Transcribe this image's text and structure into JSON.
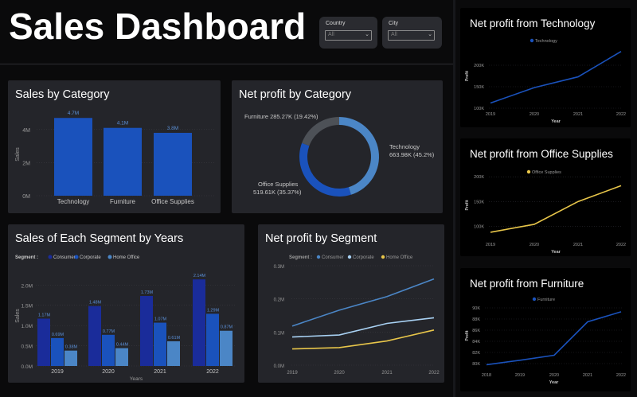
{
  "header": {
    "title": "Sales Dashboard"
  },
  "filters": [
    {
      "label": "Country",
      "value": "All"
    },
    {
      "label": "City",
      "value": "All"
    }
  ],
  "colors": {
    "dark_blue": "#1a2c9a",
    "blue": "#1a52bc",
    "steel_blue": "#4b86c6",
    "light_blue": "#a9d2f4",
    "yellow": "#e8c64a",
    "gray": "#4d5157"
  },
  "panels": {
    "sales_by_category": {
      "title": "Sales by Category",
      "chart_data": {
        "type": "bar",
        "ylabel": "Sales",
        "yticks": [
          "0M",
          "2M",
          "4M"
        ],
        "ylim": [
          0,
          5
        ],
        "categories": [
          "Technology",
          "Furniture",
          "Office Supplies"
        ],
        "values": [
          4.7,
          4.1,
          3.8
        ],
        "labels": [
          "4.7M",
          "4.1M",
          "3.8M"
        ]
      }
    },
    "net_profit_by_category": {
      "title": "Net profit by Category",
      "chart_data": {
        "type": "pie",
        "slices": [
          {
            "name": "Technology",
            "value": 663.98,
            "label_line1": "Technology",
            "label_line2": "663.98K (45.2%)"
          },
          {
            "name": "Office Supplies",
            "value": 519.61,
            "label_line1": "Office Supplies",
            "label_line2": "519.61K (35.37%)"
          },
          {
            "name": "Furniture",
            "value": 285.27,
            "label_line1": "Furniture 285.27K (19.42%)",
            "label_line2": ""
          }
        ]
      }
    },
    "sales_segment_years": {
      "title": "Sales of Each Segment by Years",
      "chart_data": {
        "type": "bar",
        "legend_title": "Segment :",
        "xlabel": "Years",
        "ylabel": "Sales",
        "yticks": [
          "0.0M",
          "0.5M",
          "1.0M",
          "1.5M",
          "2.0M"
        ],
        "ylim": [
          0,
          2.3
        ],
        "categories": [
          "2019",
          "2020",
          "2021",
          "2022"
        ],
        "series": [
          {
            "name": "Consumer",
            "values": [
              1.17,
              1.48,
              1.73,
              2.14
            ],
            "labels": [
              "1.17M",
              "1.48M",
              "1.73M",
              "2.14M"
            ]
          },
          {
            "name": "Corporate",
            "values": [
              0.69,
              0.77,
              1.07,
              1.29
            ],
            "labels": [
              "0.69M",
              "0.77M",
              "1.07M",
              "1.29M"
            ]
          },
          {
            "name": "Home Office",
            "values": [
              0.38,
              0.44,
              0.61,
              0.87
            ],
            "labels": [
              "0.38M",
              "0.44M",
              "0.61M",
              "0.87M"
            ]
          }
        ]
      }
    },
    "net_profit_segment": {
      "title": "Net profit by Segment",
      "chart_data": {
        "type": "line",
        "legend_title": "Segment :",
        "yticks": [
          "0.0M",
          "0.1M",
          "0.2M",
          "0.3M"
        ],
        "ylim": [
          0,
          0.3
        ],
        "x": [
          "2019",
          "2020",
          "2021",
          "2022"
        ],
        "series": [
          {
            "name": "Consumer",
            "values": [
              0.118,
              0.166,
              0.207,
              0.26
            ]
          },
          {
            "name": "Corporate",
            "values": [
              0.085,
              0.091,
              0.126,
              0.143
            ]
          },
          {
            "name": "Home Office",
            "values": [
              0.049,
              0.053,
              0.073,
              0.106
            ]
          }
        ]
      }
    },
    "np_technology": {
      "title": "Net profit from Technology",
      "chart_data": {
        "type": "line",
        "legend": "Technology",
        "xlabel": "Year",
        "ylabel": "Profit",
        "yticks": [
          "100K",
          "150K",
          "200K"
        ],
        "ylim": [
          100,
          250
        ],
        "x": [
          "2019",
          "2020",
          "2021",
          "2022"
        ],
        "values": [
          112,
          148,
          173,
          232
        ]
      }
    },
    "np_office": {
      "title": "Net profit from Office Supplies",
      "chart_data": {
        "type": "line",
        "legend": "Office Supplies",
        "xlabel": "Year",
        "ylabel": "Profit",
        "yticks": [
          "100K",
          "150K",
          "200K"
        ],
        "ylim": [
          75,
          210
        ],
        "x": [
          "2019",
          "2020",
          "2021",
          "2022"
        ],
        "values": [
          88,
          104,
          150,
          182
        ]
      }
    },
    "np_furniture": {
      "title": "Net profit from Furniture",
      "chart_data": {
        "type": "line",
        "legend": "Furniture",
        "xlabel": "Year",
        "ylabel": "Profit",
        "yticks": [
          "80K",
          "82K",
          "84K",
          "86K",
          "88K",
          "90K"
        ],
        "ylim": [
          79,
          91
        ],
        "x": [
          "2018",
          "2019",
          "2020",
          "2021",
          "2022"
        ],
        "values": [
          79.8,
          80.6,
          81.5,
          87.5,
          89.3
        ]
      }
    }
  }
}
